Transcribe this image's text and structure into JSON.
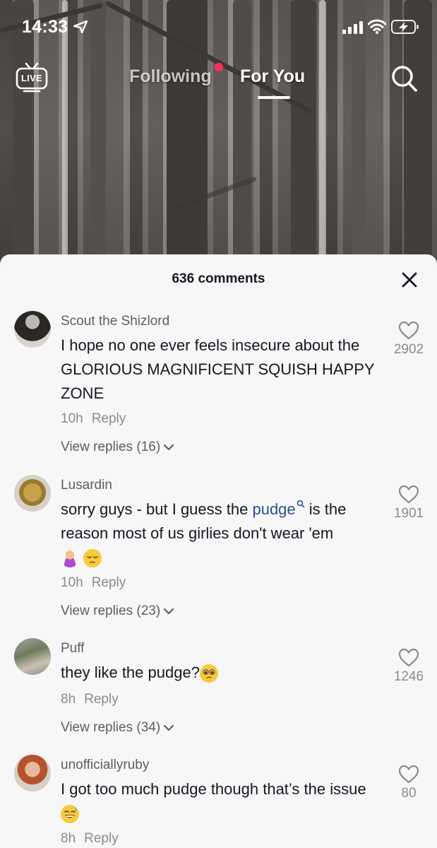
{
  "status_bar": {
    "time": "14:33"
  },
  "nav": {
    "live_label": "LIVE",
    "tab_following": "Following",
    "tab_foryou": "For You"
  },
  "comments_header": {
    "title": "636 comments"
  },
  "comments": [
    {
      "username": "Scout the Shizlord",
      "text": "I hope no one ever feels insecure about the GLORIOUS MAGNIFICENT SQUISH HAPPY ZONE",
      "time": "10h",
      "reply": "Reply",
      "view_replies": "View replies (16)",
      "likes": "2902"
    },
    {
      "username": "Lusardin",
      "text_before": "sorry guys - but I guess the ",
      "link": "pudge",
      "text_after": " is the reason most of us girlies don't wear 'em",
      "time": "10h",
      "reply": "Reply",
      "view_replies": "View replies (23)",
      "likes": "1901"
    },
    {
      "username": "Puff",
      "text": "they like the pudge?",
      "time": "8h",
      "reply": "Reply",
      "view_replies": "View replies (34)",
      "likes": "1246"
    },
    {
      "username": "unofficiallyruby",
      "text": "I got too much pudge though that’s the issue",
      "time": "8h",
      "reply": "Reply",
      "likes": "80"
    }
  ]
}
